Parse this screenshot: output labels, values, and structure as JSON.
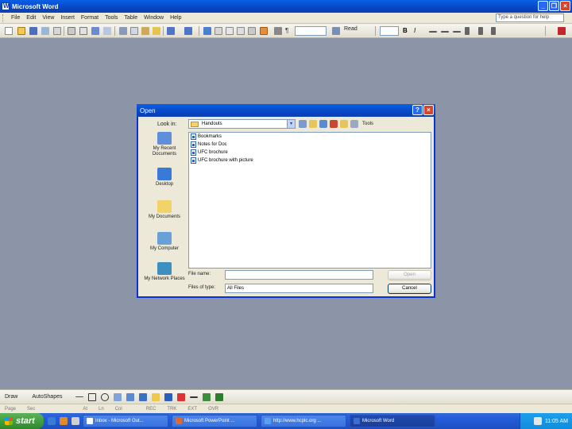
{
  "window": {
    "title": "Microsoft Word"
  },
  "menu": {
    "items": [
      "File",
      "Edit",
      "View",
      "Insert",
      "Format",
      "Tools",
      "Table",
      "Window",
      "Help"
    ],
    "help_box": "Type a question for help"
  },
  "toolbar": {
    "read_label": "Read"
  },
  "dialog": {
    "title": "Open",
    "look_in_label": "Look in:",
    "look_in_value": "Handouts",
    "tools_label": "Tools",
    "places": [
      "My Recent Documents",
      "Desktop",
      "My Documents",
      "My Computer",
      "My Network Places"
    ],
    "files": [
      "Bookmarks",
      "Notes for Doc",
      "UFC brochure",
      "UFC brochure with picture"
    ],
    "file_name_label": "File name:",
    "file_name_value": "",
    "files_of_type_label": "Files of type:",
    "files_of_type_value": "All Files",
    "open_button": "Open",
    "cancel_button": "Cancel"
  },
  "drawing": {
    "draw_label": "Draw",
    "autoshapes_label": "AutoShapes"
  },
  "status": {
    "page": "Page",
    "sec": "Sec",
    "at": "At",
    "ln": "Ln",
    "col": "Col",
    "rec": "REC",
    "trk": "TRK",
    "ext": "EXT",
    "ovr": "OVR"
  },
  "taskbar": {
    "start_label": "start",
    "buttons": [
      "Inbox - Microsoft Out...",
      "Microsoft PowerPoint ...",
      "http://www.hcplc.org ...",
      "Microsoft Word"
    ],
    "clock": "11:05 AM"
  }
}
